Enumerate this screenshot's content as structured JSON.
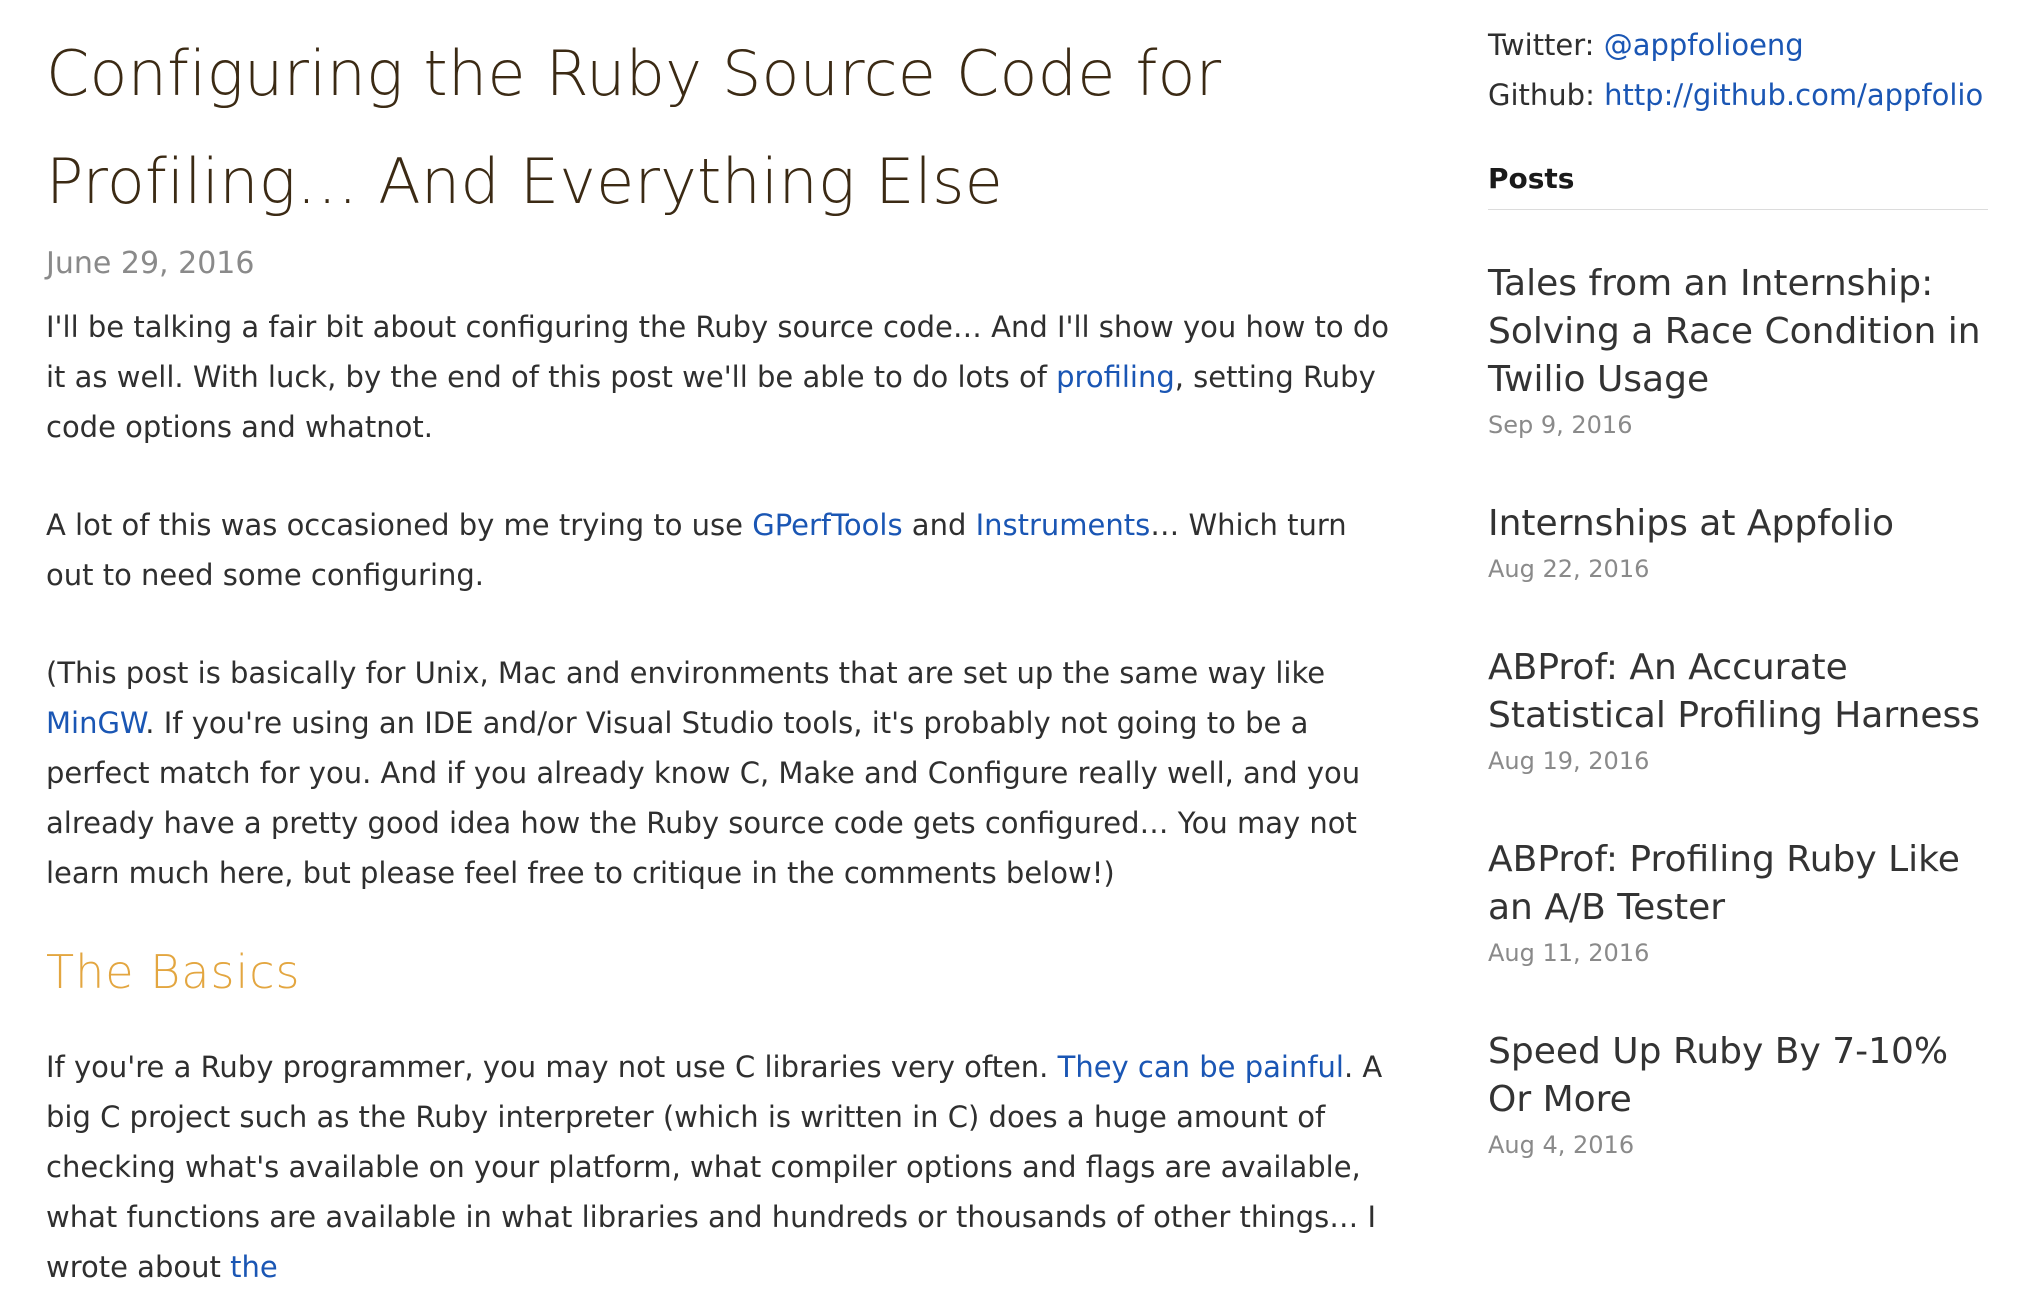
{
  "article": {
    "title_line1": "Configuring the Ruby Source Code for",
    "title_line2": "Profiling… And Everything Else",
    "date": "June 29, 2016",
    "p1": {
      "text_a": "I'll be talking a fair bit about configuring the Ruby source code… And I'll show you how to do it as well. With luck, by the end of this post we'll be able to do lots of ",
      "link_profiling": "profiling",
      "text_b": ", setting Ruby code options and whatnot."
    },
    "p2": {
      "text_a": "A lot of this was occasioned by me trying to use ",
      "link_gperftools": "GPerfTools",
      "text_b": " and ",
      "link_instruments": "Instruments",
      "text_c": "… Which turn out to need some configuring."
    },
    "p3": {
      "text_a": "(This post is basically for Unix, Mac and environments that are set up the same way like ",
      "link_mingw": "MinGW",
      "text_b": ". If you're using an IDE and/or Visual Studio tools, it's probably not going to be a perfect match for you. And if you already know C, Make and Configure really well, and you already have a pretty good idea how the Ruby source code gets configured… You may not learn much here, but please feel free to critique in the comments below!)"
    },
    "section_heading": "The Basics",
    "p4": {
      "text_a": "If you're a Ruby programmer, you may not use C libraries very often. ",
      "link_painful": "They can be painful",
      "text_b": ". A big C project such as the Ruby interpreter (which is written in C) does a huge amount of checking what's available on your platform, what compiler options and flags are available, what functions are available in what libraries and hundreds or thousands of other things… I wrote about ",
      "link_the": "the"
    }
  },
  "sidebar": {
    "twitter_label": "Twitter: ",
    "twitter_link": "@appfolioeng",
    "github_label": "Github: ",
    "github_link": "http://github.com/appfolio",
    "posts_heading": "Posts",
    "posts": [
      {
        "title": "Tales from an Internship: Solving a Race Condition in Twilio Usage",
        "date": "Sep 9, 2016"
      },
      {
        "title": "Internships at Appfolio",
        "date": "Aug 22, 2016"
      },
      {
        "title": "ABProf: An Accurate Statistical Profiling Harness",
        "date": "Aug 19, 2016"
      },
      {
        "title": "ABProf: Profiling Ruby Like an A/B Tester",
        "date": "Aug 11, 2016"
      },
      {
        "title": "Speed Up Ruby By 7-10% Or More",
        "date": "Aug 4, 2016"
      }
    ]
  },
  "colors": {
    "title": "#3b2a14",
    "link": "#1a56b4",
    "section_heading": "#e3a640",
    "muted": "#8a8a8a"
  }
}
